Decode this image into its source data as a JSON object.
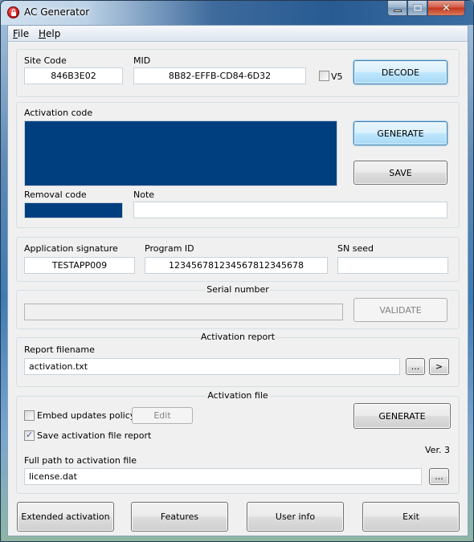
{
  "window": {
    "title": "AC Generator",
    "controls": {
      "minimize": "minimize",
      "maximize": "maximize",
      "close": "close"
    }
  },
  "menu": {
    "items": [
      {
        "label": "File",
        "accel": "F",
        "rest": "ile"
      },
      {
        "label": "Help",
        "accel": "H",
        "rest": "elp"
      }
    ]
  },
  "decode_section": {
    "site_code_label": "Site Code",
    "site_code_value": "846B3E02",
    "mid_label": "MID",
    "mid_value": "8B82-EFFB-CD84-6D32",
    "v5_label": "V5",
    "v5_checked": false,
    "decode_button": "DECODE"
  },
  "activation_section": {
    "activation_code_label": "Activation code",
    "activation_code_value": "",
    "generate_button": "GENERATE",
    "save_button": "SAVE",
    "removal_code_label": "Removal code",
    "removal_code_value": "",
    "note_label": "Note",
    "note_value": "",
    "selection_color": "#003f7f"
  },
  "app_section": {
    "app_signature_label": "Application signature",
    "app_signature_value": "TESTAPP009",
    "program_id_label": "Program ID",
    "program_id_value": "12345678123456781234567­8",
    "sn_seed_label": "SN seed",
    "sn_seed_value": ""
  },
  "serial_section": {
    "legend": "Serial number",
    "serial_value": "",
    "validate_button": "VALIDATE"
  },
  "report_section": {
    "legend": "Activation report",
    "report_filename_label": "Report filename",
    "report_filename_value": "activation.txt",
    "browse_button": "...",
    "open_button": ">"
  },
  "activation_file_section": {
    "legend": "Activation file",
    "embed_policy_label": "Embed updates policy",
    "embed_policy_checked": false,
    "edit_button": "Edit",
    "save_report_label": "Save activation file report",
    "save_report_checked": true,
    "generate_button": "GENERATE",
    "version_text": "Ver. 3",
    "full_path_label": "Full path to activation file",
    "full_path_value": "license.dat",
    "browse_button": "..."
  },
  "footer": {
    "extended_activation_button": "Extended activation",
    "features_button": "Features",
    "user_info_button": "User info",
    "exit_button": "Exit"
  }
}
